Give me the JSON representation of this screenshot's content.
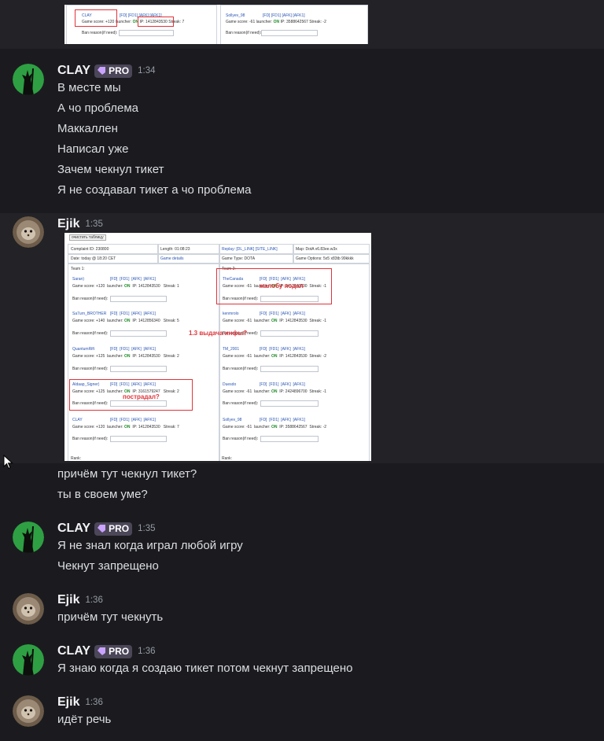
{
  "top_screenshot": {
    "player": "CLAY",
    "links": [
      "[FD]",
      "[FD1]",
      "[AFK]",
      "[AFK1]"
    ],
    "score": "Game score: +120",
    "launcher_label": "launcher:",
    "launcher_on": "ON",
    "ip": "IP: 1412843530",
    "streak": "Streak: 7",
    "ban_reason": "Ban reason(if need):",
    "right_player": "Sollyev_98",
    "right_score": "Game score: -61",
    "right_ip": "IP: 3588642567",
    "right_streak": "Streak: -2"
  },
  "messages": [
    {
      "author": "CLAY",
      "badge": "PRO",
      "time": "1:34",
      "lines": [
        "В месте мы",
        "А чо проблема",
        "Маккаллен",
        "Написал уже",
        "Зачем чекнул тикет",
        "Я не создавал тикет а чо проблема"
      ]
    },
    {
      "author": "Ejik",
      "time": "1:35",
      "lines": [
        "причём тут чекнул тикет?",
        "ты в своем уме?"
      ]
    },
    {
      "author": "CLAY",
      "badge": "PRO",
      "time": "1:35",
      "lines": [
        "Я не знал когда играл любой игру",
        "Чекнут запрещено"
      ]
    },
    {
      "author": "Ejik",
      "time": "1:36",
      "lines": [
        "причём тут чекнуть"
      ]
    },
    {
      "author": "CLAY",
      "badge": "PRO",
      "time": "1:36",
      "lines": [
        "Я знаю когда я создаю тикет потом чекнут запрещено"
      ]
    },
    {
      "author": "Ejik",
      "time": "1:36",
      "lines": [
        "идёт речь"
      ]
    }
  ],
  "attachment": {
    "clear_button": "очистить таблицу",
    "info": {
      "complaint": "Complaint ID: 230800",
      "length": "Length: 01:08:23",
      "replay": "Replay: [DL_LINK] [SITE_LINK]",
      "map": "Map: DotA v6.83ee.w3x",
      "date": "Date: today @ 18:20 CET",
      "game_details": "Game details",
      "game_type": "Game Type: DOTA",
      "game_options": "Game Options: 5x5 x83tb 99kkkk"
    },
    "team1_label": "Team 1:",
    "team2_label": "Team 2:",
    "links": [
      "[FD]",
      "[FD1]",
      "[AFK]",
      "[AFK1]"
    ],
    "launcher_label": "launcher:",
    "launcher_on": "ON",
    "ban_reason": "Ban reason(if need):",
    "rank_label": "Rank:",
    "team1": [
      {
        "name": "Saran)",
        "score": "Game score: +120",
        "ip": "IP: 1412843530",
        "streak": "Streak: 1"
      },
      {
        "name": "Sa7urn_BROTHER",
        "score": "Game score: +140",
        "ip": "IP: 1412856340",
        "streak": "Streak: 5"
      },
      {
        "name": "QuantumRift",
        "score": "Game score: +125",
        "ip": "IP: 1412843530",
        "streak": "Streak: 2"
      },
      {
        "name": "Aldaap_Signer)",
        "score": "Game score: +125",
        "ip": "IP: 3161579247",
        "streak": "Streak: 2"
      },
      {
        "name": "CLAY",
        "score": "Game score: +120",
        "ip": "IP: 1412843530",
        "streak": "Streak: 7"
      }
    ],
    "team2": [
      {
        "name": "TheCanada",
        "score": "Game score: -61",
        "ip": "IP: 1412843530",
        "streak": "Streak: -1"
      },
      {
        "name": "kenmrolo",
        "score": "Game score: -61",
        "ip": "IP: 1412843530",
        "streak": "Streak: -1"
      },
      {
        "name": "TM_2001",
        "score": "Game score: -61",
        "ip": "IP: 1412843530",
        "streak": "Streak: -2"
      },
      {
        "name": "Duesdo",
        "score": "Game score: -61",
        "ip": "IP: 2424896700",
        "streak": "Streak: -1"
      },
      {
        "name": "Sollyev_98",
        "score": "Game score: -61",
        "ip": "IP: 3588642567",
        "streak": "Streak: -2"
      }
    ],
    "annotations": {
      "complaint": "жалобу подал",
      "rule": "1.3 выдача инфы?",
      "victim": "пострадал?"
    }
  },
  "colors": {
    "background": "#1b1b1f",
    "highlight": "#222227",
    "badge": "#4b4658",
    "text": "#dbdee1",
    "muted": "#949ba4",
    "annotation_red": "#e0343a"
  }
}
